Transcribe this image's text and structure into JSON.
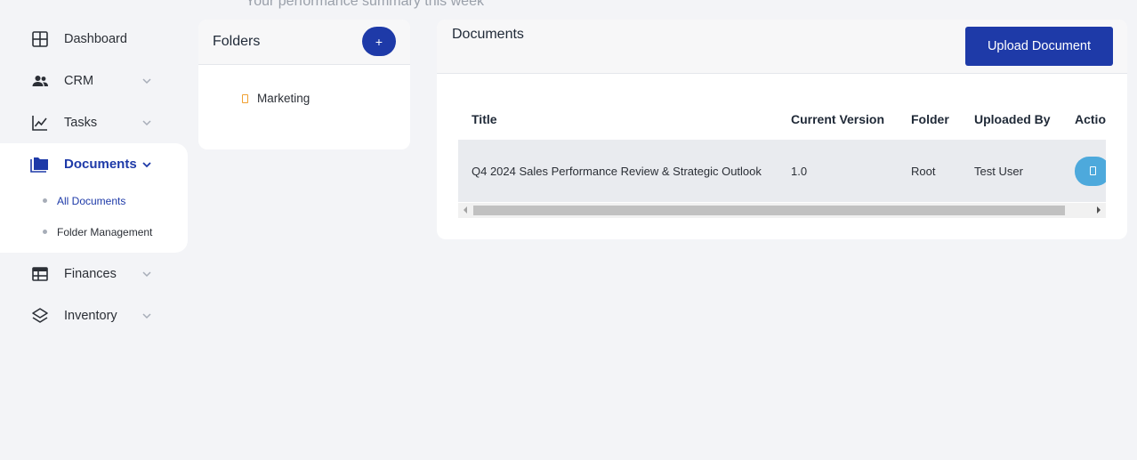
{
  "header": {
    "subtitle": "Your performance summary this week"
  },
  "sidebar": {
    "items": [
      {
        "label": "Dashboard",
        "icon": "grid-icon"
      },
      {
        "label": "CRM",
        "icon": "users-icon"
      },
      {
        "label": "Tasks",
        "icon": "chart-line-icon"
      },
      {
        "label": "Documents",
        "icon": "folder-icon",
        "active": true,
        "subitems": [
          {
            "label": "All Documents",
            "active": true
          },
          {
            "label": "Folder Management"
          }
        ]
      },
      {
        "label": "Finances",
        "icon": "table-icon"
      },
      {
        "label": "Inventory",
        "icon": "layers-icon"
      }
    ]
  },
  "folders": {
    "title": "Folders",
    "add_label": "+",
    "items": [
      {
        "name": "Marketing"
      }
    ]
  },
  "documents": {
    "title": "Documents",
    "upload_label": "Upload Document",
    "columns": [
      "Title",
      "Current Version",
      "Folder",
      "Uploaded By",
      "Actio"
    ],
    "rows": [
      {
        "title": "Q4 2024 Sales Performance Review & Strategic Outlook",
        "version": "1.0",
        "folder": "Root",
        "uploaded_by": "Test User"
      }
    ]
  },
  "colors": {
    "accent": "#1e3aa8",
    "action": "#4da9dc",
    "background": "#f3f4f7"
  }
}
